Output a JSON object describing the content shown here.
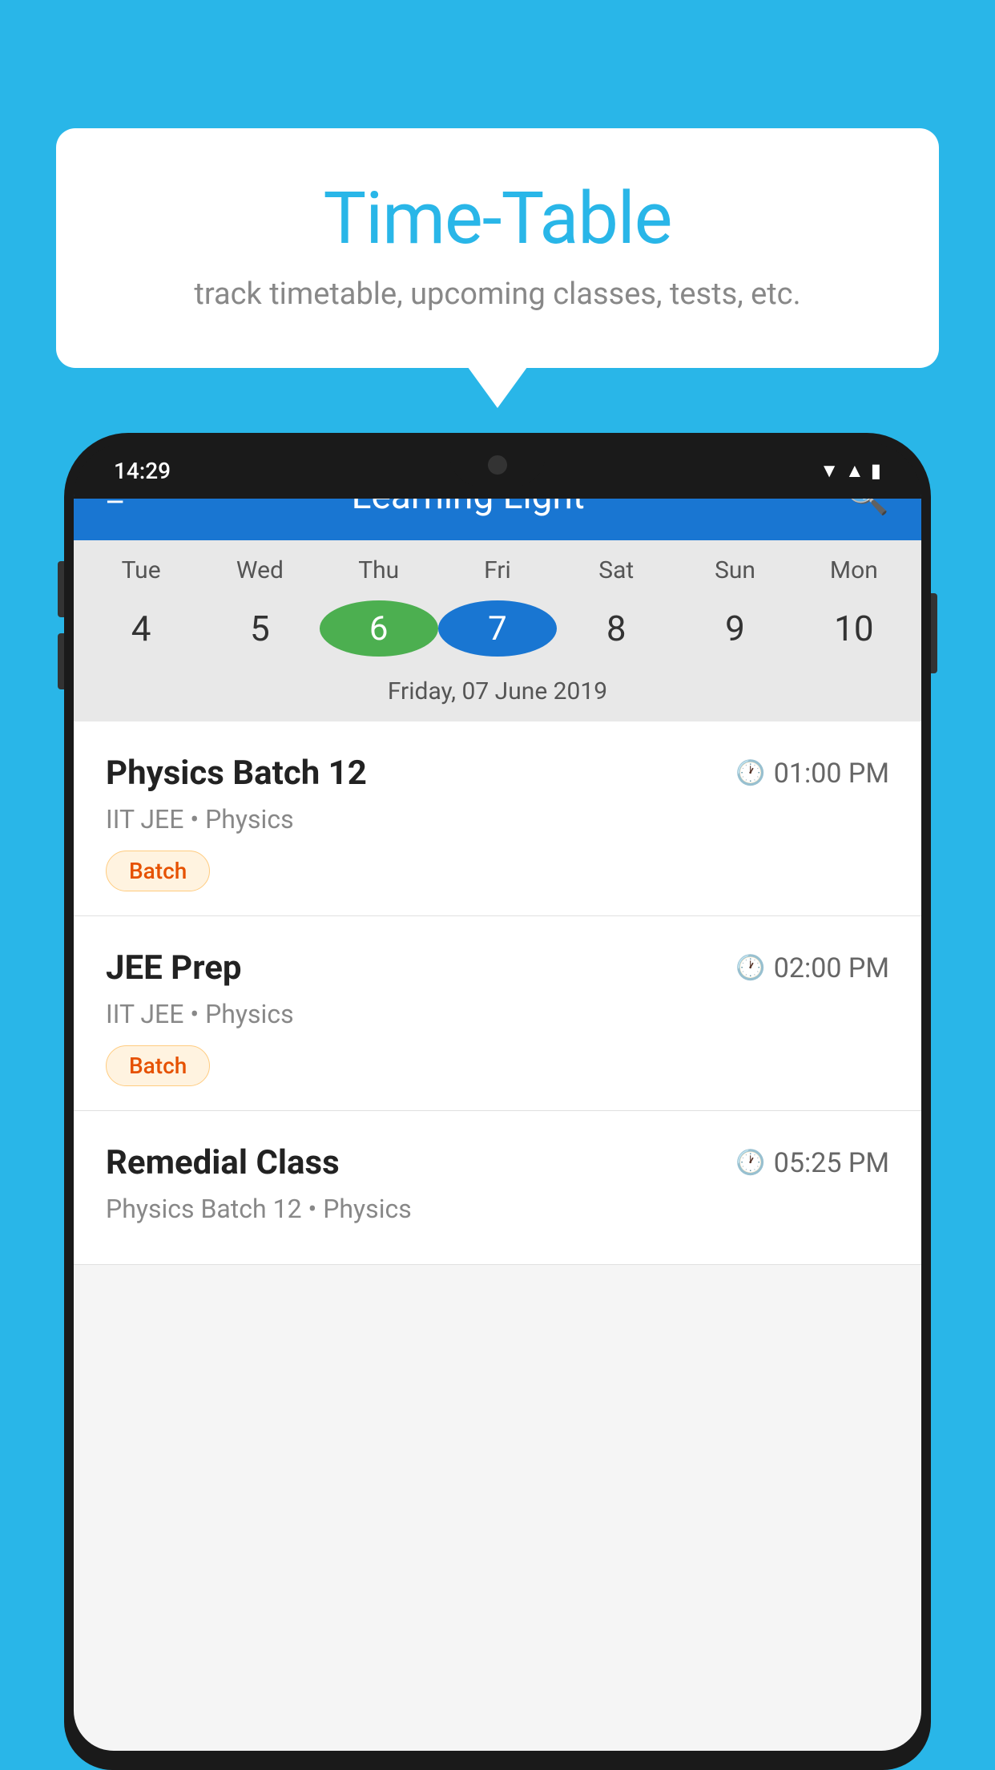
{
  "background_color": "#29B6E8",
  "bubble": {
    "title": "Time-Table",
    "subtitle": "track timetable, upcoming classes, tests, etc."
  },
  "app": {
    "title": "Learning Light"
  },
  "status_bar": {
    "time": "14:29"
  },
  "calendar": {
    "days": [
      {
        "label": "Tue",
        "num": "4"
      },
      {
        "label": "Wed",
        "num": "5"
      },
      {
        "label": "Thu",
        "num": "6",
        "state": "today"
      },
      {
        "label": "Fri",
        "num": "7",
        "state": "selected"
      },
      {
        "label": "Sat",
        "num": "8"
      },
      {
        "label": "Sun",
        "num": "9"
      },
      {
        "label": "Mon",
        "num": "10"
      }
    ],
    "selected_date": "Friday, 07 June 2019"
  },
  "classes": [
    {
      "name": "Physics Batch 12",
      "time": "01:00 PM",
      "meta": "IIT JEE • Physics",
      "badge": "Batch"
    },
    {
      "name": "JEE Prep",
      "time": "02:00 PM",
      "meta": "IIT JEE • Physics",
      "badge": "Batch"
    },
    {
      "name": "Remedial Class",
      "time": "05:25 PM",
      "meta": "Physics Batch 12 • Physics",
      "badge": ""
    }
  ]
}
